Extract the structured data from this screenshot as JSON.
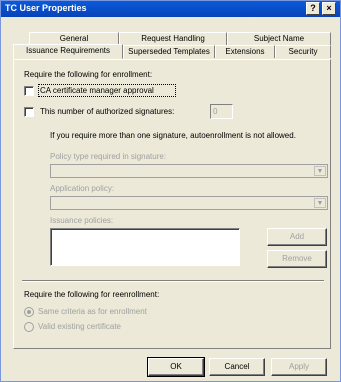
{
  "window": {
    "title": "TC User Properties",
    "help_label": "?",
    "close_label": "×"
  },
  "tabs": {
    "row_back": [
      {
        "label": "General"
      },
      {
        "label": "Request Handling"
      },
      {
        "label": "Subject Name"
      }
    ],
    "row_front": [
      {
        "label": "Issuance Requirements",
        "active": true
      },
      {
        "label": "Superseded Templates"
      },
      {
        "label": "Extensions"
      },
      {
        "label": "Security"
      }
    ]
  },
  "enrollment": {
    "heading": "Require the following for enrollment:",
    "ca_approval_label": "CA certificate manager approval",
    "ca_approval_checked": false,
    "sig_count_label": "This number of authorized signatures:",
    "sig_count_checked": false,
    "sig_count_value": "0",
    "multi_sig_note": "If you require more than one signature, autoenrollment is not allowed.",
    "policy_type_label": "Policy type required in signature:",
    "policy_type_value": "",
    "app_policy_label": "Application policy:",
    "app_policy_value": "",
    "issuance_label": "Issuance policies:",
    "add_button": "Add",
    "remove_button": "Remove"
  },
  "reenrollment": {
    "heading": "Require the following for reenrollment:",
    "same_criteria_label": "Same criteria as for enrollment",
    "same_criteria_selected": true,
    "valid_cert_label": "Valid existing certificate",
    "valid_cert_selected": false
  },
  "buttons": {
    "ok": "OK",
    "cancel": "Cancel",
    "apply": "Apply"
  },
  "colors": {
    "titlebar": "#0a5bd8",
    "dialog_bg": "#ece9d8",
    "disabled_text": "#a0a0a0"
  }
}
